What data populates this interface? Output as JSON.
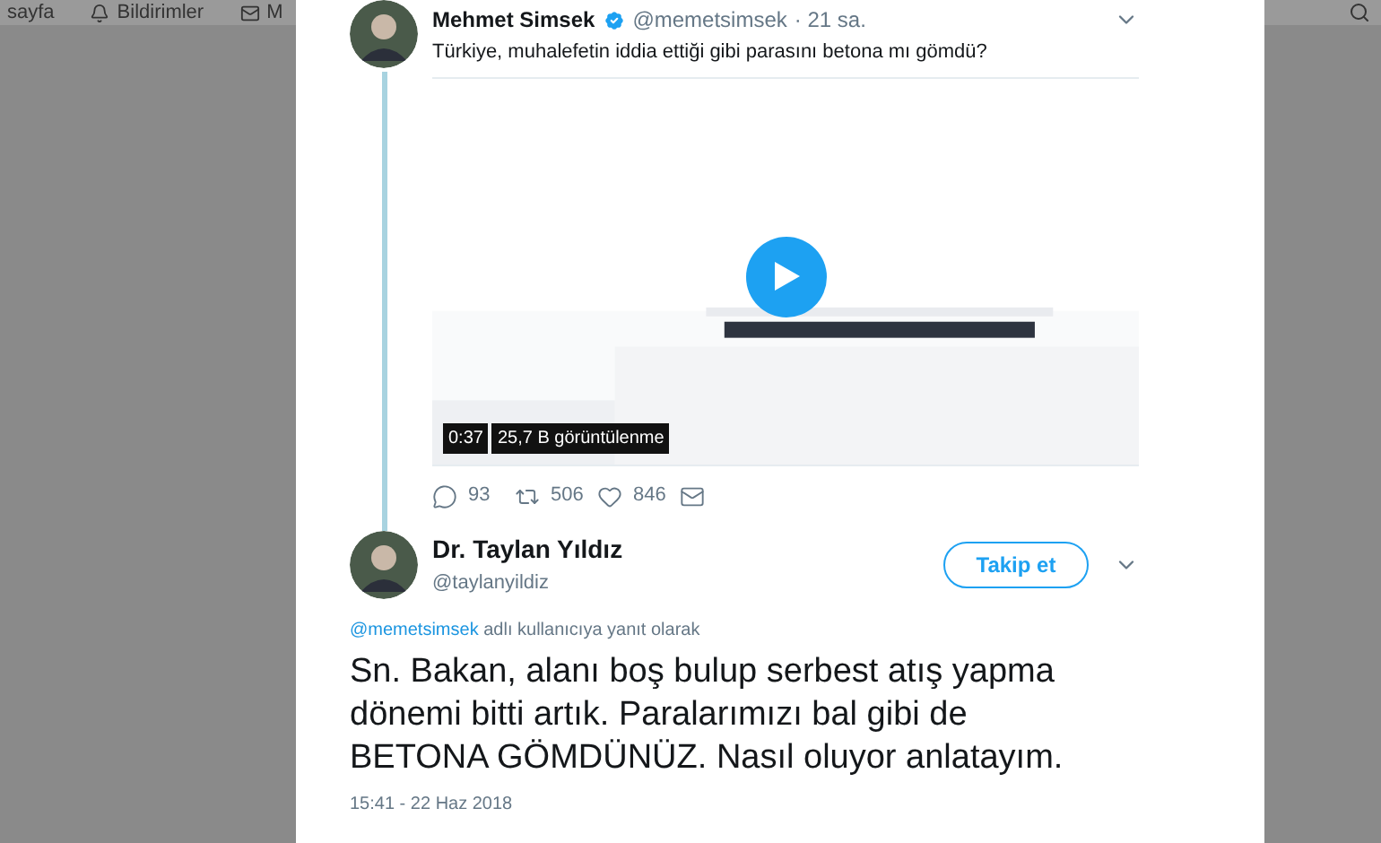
{
  "nav": {
    "items": [
      {
        "label": "sayfa"
      },
      {
        "label": "Bildirimler"
      },
      {
        "label": "M"
      }
    ]
  },
  "tweet": {
    "name": "Mehmet Simsek",
    "verified": true,
    "handle": "@memetsimsek",
    "time": "· 21 sa.",
    "text": "Türkiye, muhalefetin iddia ettiği gibi parasını betona mı gömdü?",
    "video": {
      "kind": "picture",
      "duration": "0:37",
      "views": "25,7 B görüntülenme"
    },
    "actions": [
      {
        "kind": "reply",
        "count": "93"
      },
      {
        "kind": "retweet",
        "count": "506"
      },
      {
        "kind": "like",
        "count": "846"
      },
      {
        "kind": "message"
      }
    ]
  },
  "reply": {
    "name": "Dr. Taylan Yıldız",
    "handle": "@taylanyildiz",
    "follow_button": "Takip et",
    "reply_to": "@memetsimsek",
    "reply_to_suffix": "adlı kullanıcıya yanıt olarak",
    "text": "Sn. Bakan, alanı boş bulup serbest atış yapma dönemi bitti artık. Paralarımızı bal gibi de BETONA GÖMDÜNÜZ. Nasıl oluyor anlatayım.",
    "timestamp": "15:41 - 22 Haz 2018"
  }
}
